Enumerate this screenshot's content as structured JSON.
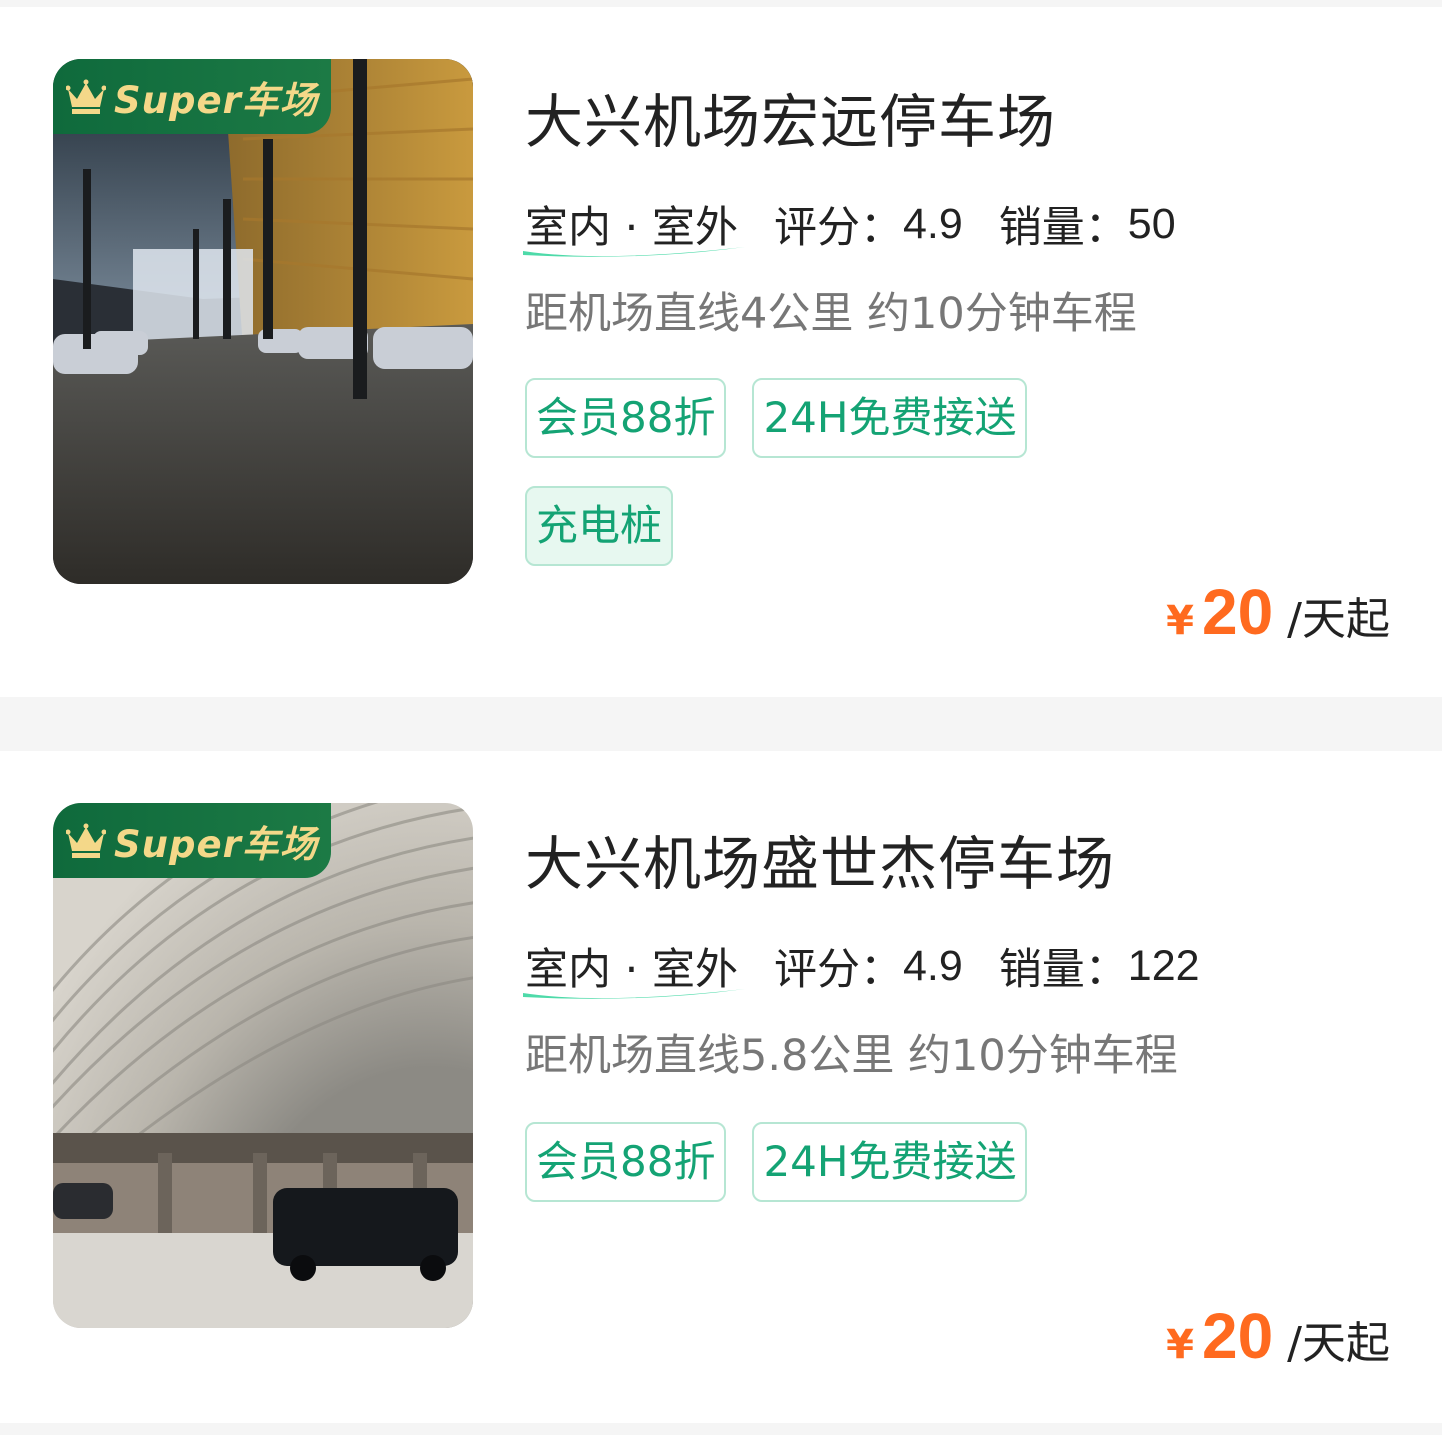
{
  "lots": [
    {
      "badge": "Super车场",
      "name": "大兴机场宏远停车场",
      "location_types": "室内 · 室外",
      "rating_label": "评分：",
      "rating": "4.9",
      "sales_label": "销量：",
      "sales": "50",
      "distance": "距机场直线4公里 约10分钟车程",
      "tags": [
        "会员88折",
        "24H免费接送",
        "充电桩"
      ],
      "currency": "¥",
      "price": "20",
      "price_unit": "/天起"
    },
    {
      "badge": "Super车场",
      "name": "大兴机场盛世杰停车场",
      "location_types": "室内 · 室外",
      "rating_label": "评分：",
      "rating": "4.9",
      "sales_label": "销量：",
      "sales": "122",
      "distance": "距机场直线5.8公里 约10分钟车程",
      "tags": [
        "会员88折",
        "24H免费接送"
      ],
      "currency": "¥",
      "price": "20",
      "price_unit": "/天起"
    }
  ],
  "colors": {
    "accent_green": "#14a374",
    "price_orange": "#ff6a1f",
    "badge_green": "#0f6a3c",
    "badge_gold": "#f4d889"
  },
  "icons": {
    "badge": "crown-icon"
  }
}
